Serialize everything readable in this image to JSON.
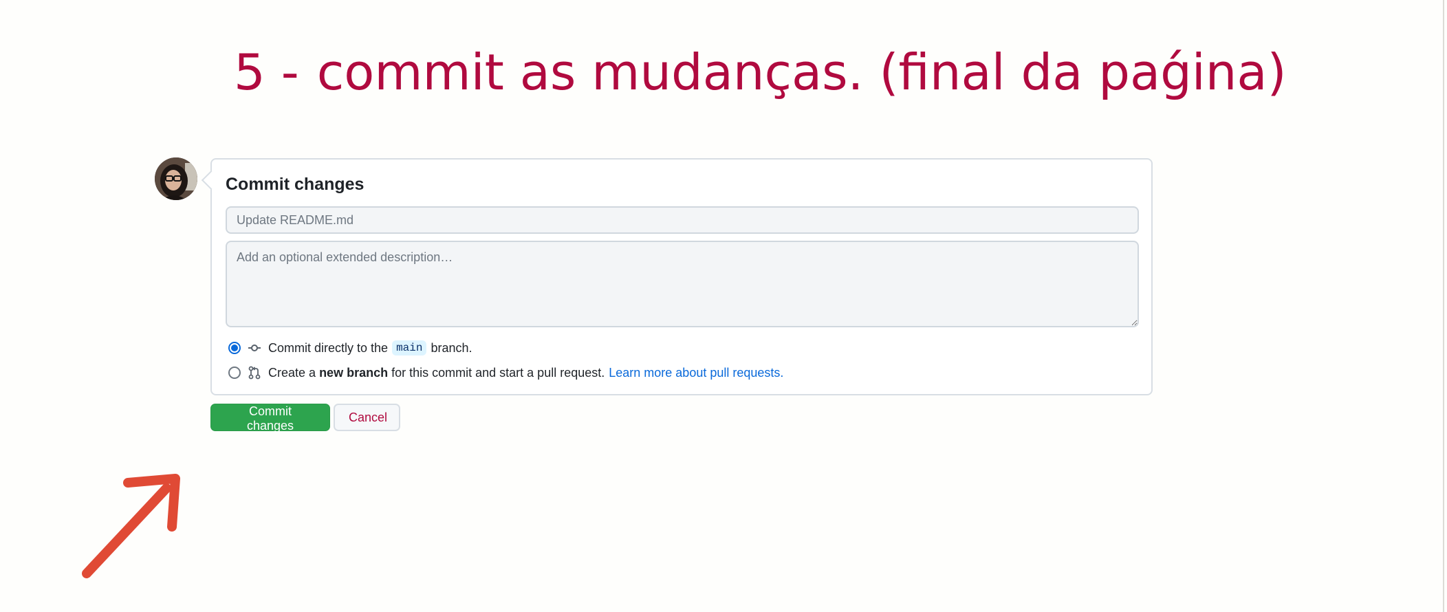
{
  "slide": {
    "step_number": "5 -",
    "title": "commit as mudanças. (final da paǵina)"
  },
  "commit_panel": {
    "title": "Commit changes",
    "summary_placeholder": "Update README.md",
    "description_placeholder": "Add an optional extended description…",
    "option_direct": {
      "text_before": "Commit directly to the",
      "branch": "main",
      "text_after": "branch.",
      "selected": true
    },
    "option_new_branch": {
      "text_before": "Create a",
      "bold": "new branch",
      "text_after": "for this commit and start a pull request.",
      "link": "Learn more about pull requests.",
      "selected": false
    }
  },
  "actions": {
    "commit_label": "Commit changes",
    "cancel_label": "Cancel"
  },
  "colors": {
    "title": "#b00a3f",
    "primary_button": "#2da44e",
    "link": "#0969da",
    "arrow": "#e04a35"
  },
  "icons": [
    "avatar",
    "git-commit-icon",
    "git-pull-request-icon",
    "arrow-icon"
  ]
}
